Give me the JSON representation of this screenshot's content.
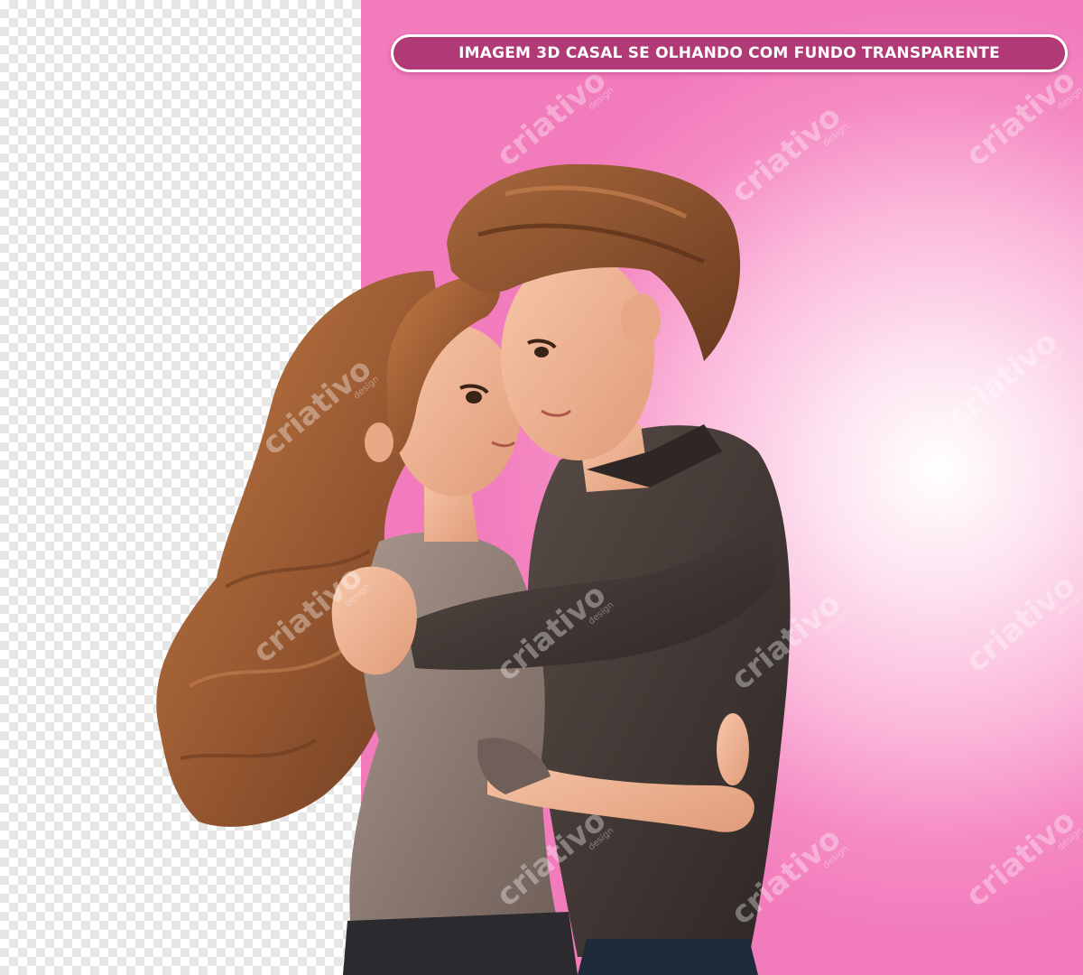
{
  "banner": {
    "title": "IMAGEM 3D CASAL SE OLHANDO COM FUNDO TRANSPARENTE"
  },
  "watermark": {
    "brand": "criativo",
    "sub": "design"
  },
  "colors": {
    "banner_fill": "#b03a75",
    "banner_border": "#ffffff",
    "pink_background": "#f27bbc",
    "checker_light": "#ffffff",
    "checker_dark": "#e6e6e6",
    "hair": "#9a5a32",
    "skin": "#f0b493",
    "man_sweater": "#3f3633",
    "woman_top": "#8c7a72"
  }
}
